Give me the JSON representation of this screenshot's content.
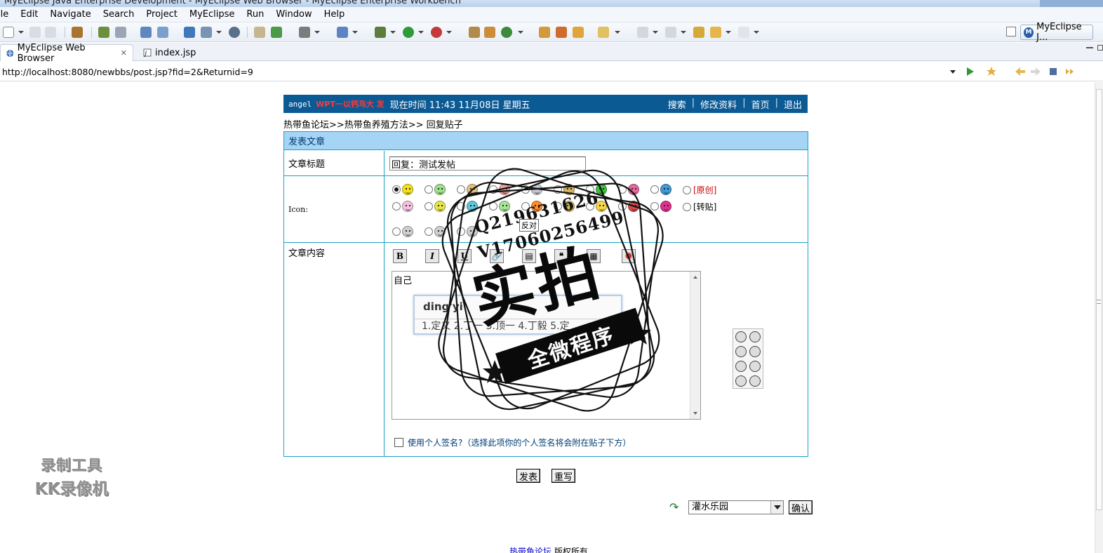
{
  "window": {
    "title": "MyEclipse Java Enterprise Development - MyEclipse Web Browser - MyEclipse Enterprise Workbench"
  },
  "menu": [
    "ile",
    "Edit",
    "Navigate",
    "Search",
    "Project",
    "MyEclipse",
    "Run",
    "Window",
    "Help"
  ],
  "perspective": {
    "label": "MyEclipse J..."
  },
  "tabs": [
    {
      "label": "MyEclipse Web Browser",
      "icon": "globe-icon",
      "active": true
    },
    {
      "label": "index.jsp",
      "icon": "jsp-file-icon",
      "active": false
    }
  ],
  "address": {
    "url": "http://localhost:8080/newbbs/post.jsp?fid=2&Returnid=9"
  },
  "forum_header": {
    "user": "angel",
    "rank": "WPT一以钙鸟大 发",
    "time": "现在时间 11:43 11月08日 星期五",
    "links": [
      "搜索",
      "修改资料",
      "首页",
      "退出"
    ]
  },
  "breadcrumb": {
    "path": "热带鱼论坛>>热带鱼养殖方法>>",
    "current": "回复贴子"
  },
  "form": {
    "heading": "发表文章",
    "title_label": "文章标题",
    "title_value": "回复：测试发帖",
    "icon_label": "Icon:",
    "original_label": "[原创]",
    "repost_label": "[转贴]",
    "content_label": "文章内容",
    "content_text": "自己",
    "signature_label": "使用个人签名?（选择此项你的个人签名将会附在贴子下方）",
    "toolbar": {
      "bold": "B",
      "italic": "I",
      "underline": "U"
    }
  },
  "ime": {
    "pinyin": "ding'yi",
    "candidates": "1.定义  2.丁一  3.顶一  4.丁毅  5.定"
  },
  "buttons": {
    "submit": "发表",
    "reset": "重写",
    "confirm": "确认"
  },
  "jump": {
    "selected": "灌水乐园"
  },
  "footer": {
    "site": "热带鱼论坛",
    "rights": "版权所有"
  },
  "watermarks": {
    "recorder_line1": "录制工具",
    "recorder_line2": "KK录像机",
    "qq": "Q219631626",
    "wechat": "V17060256499",
    "big_text": "实拍",
    "banner": "全微程序",
    "tooltip": "反对"
  },
  "colors": {
    "header_bg": "#0c5a94",
    "form_head_bg": "#a6d4f5",
    "form_border": "#1aa3c8",
    "rank_red": "#ff3a3a"
  }
}
